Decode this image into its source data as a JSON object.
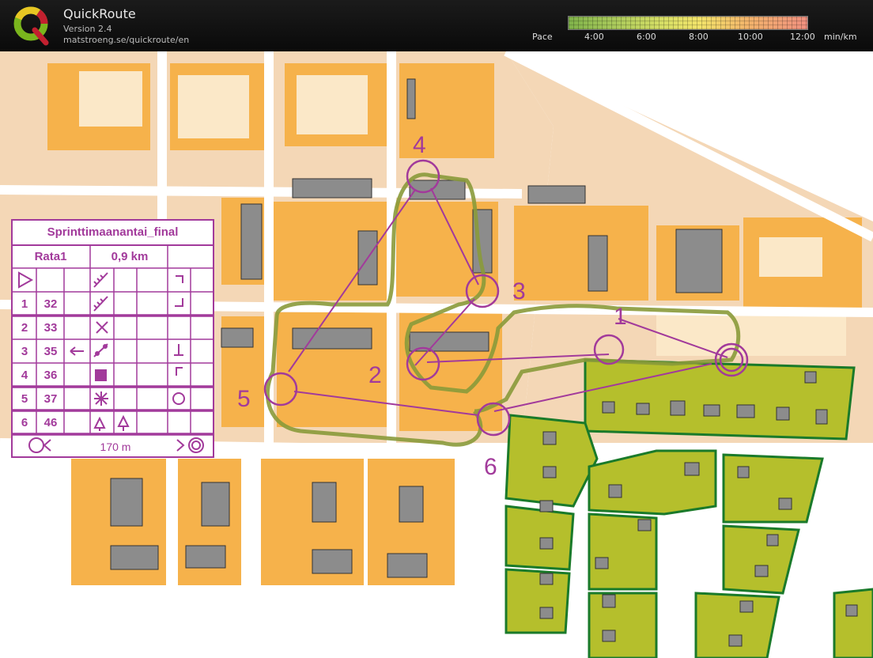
{
  "app": {
    "name": "QuickRoute",
    "version": "Version 2.4",
    "url": "matstroeng.se/quickroute/en"
  },
  "pace_legend": {
    "label": "Pace",
    "ticks": [
      "4:00",
      "6:00",
      "8:00",
      "10:00",
      "12:00"
    ],
    "unit": "min/km",
    "colors": [
      "#7fb24a",
      "#d8df66",
      "#f2e36a",
      "#f2b46b",
      "#ef8f7f"
    ]
  },
  "map": {
    "course_color": "#a23a9b",
    "route_color": "#8a9a3a",
    "control_numbers": [
      "1",
      "2",
      "3",
      "4",
      "5",
      "6"
    ]
  },
  "control_card": {
    "title": "Sprinttimaanantai_final",
    "course": "Rata1",
    "length": "0,9 km",
    "rows": [
      {
        "num": "1",
        "code": "32"
      },
      {
        "num": "2",
        "code": "33"
      },
      {
        "num": "3",
        "code": "35"
      },
      {
        "num": "4",
        "code": "36"
      },
      {
        "num": "5",
        "code": "37"
      },
      {
        "num": "6",
        "code": "46"
      }
    ],
    "finish_distance": "170 m"
  }
}
